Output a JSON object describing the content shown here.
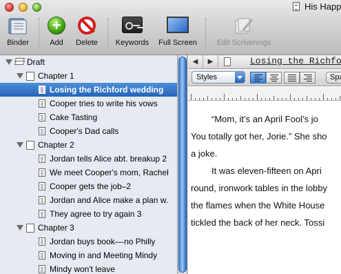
{
  "window": {
    "title": "His Happ"
  },
  "toolbar": {
    "binder": "Binder",
    "add": "Add",
    "delete": "Delete",
    "keywords": "Keywords",
    "full_screen": "Full Screen",
    "edit_scrivenings": "Edit Scrivenings"
  },
  "binder": {
    "root": "Draft",
    "chapters": [
      {
        "title": "Chapter 1",
        "docs": [
          "Losing the Richford wedding",
          "Cooper tries to write his vows",
          "Cake Tasting",
          "Cooper's Dad calls"
        ]
      },
      {
        "title": "Chapter 2",
        "docs": [
          "Jordan tells Alice abt. breakup 2",
          "We meet Cooper's mom, Rachel",
          "Cooper gets the job–2",
          "Jordan and Alice make a plan w.",
          "They agree to try again 3"
        ]
      },
      {
        "title": "Chapter 3",
        "docs": [
          "Jordan buys book––no Philly",
          "Moving in and Meeting Mindy",
          "Mindy won't leave"
        ]
      }
    ],
    "selected": "Losing the Richford wedding"
  },
  "editor": {
    "doc_title": "Losing the Richfo",
    "styles_label": "Styles",
    "spacing_label": "Spa",
    "lines": [
      "“Mom, it’s an April Fool’s jo",
      "You totally got her, Jorie.” She sho",
      "a joke.",
      "It was eleven-fifteen on Apri",
      "round, ironwork tables in the lobby",
      "the flames when the White House",
      "tickled the back of her neck. Tossi"
    ]
  },
  "colors": {
    "selection": "#2f6fc6",
    "binder_bg": "#e6ebf2"
  }
}
